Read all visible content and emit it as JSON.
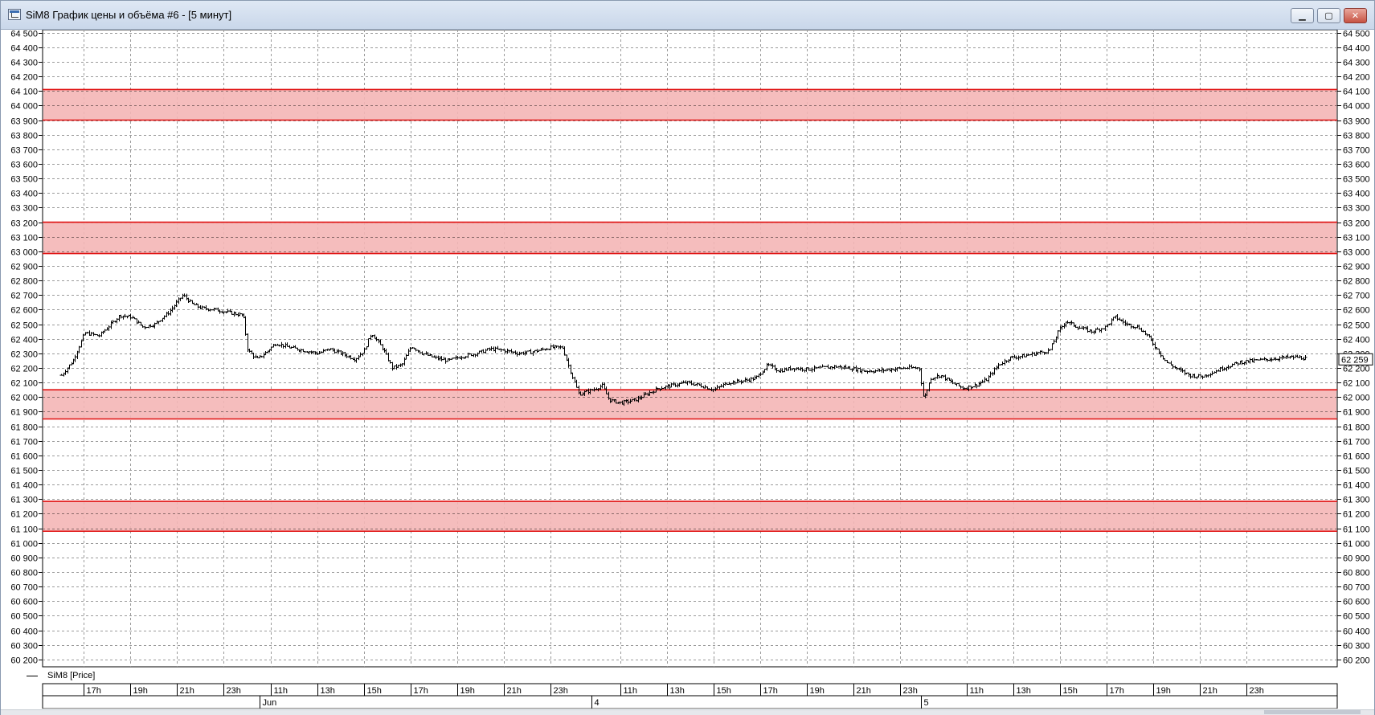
{
  "window": {
    "title": "SiM8 График цены и объёма #6 - [5 минут]",
    "buttons": {
      "minimize": "▁",
      "maximize": "▢",
      "close": "✕"
    },
    "icon": "chart-window-icon"
  },
  "legend": {
    "label": "SiM8 [Price]"
  },
  "colors": {
    "zone_fill": "#f4b6b6",
    "zone_border": "#e01010",
    "bars": "#000000",
    "grid": "#9a9a9a",
    "background": "#ffffff"
  },
  "chart_data": {
    "type": "bar",
    "style": "OHLC bars",
    "interval": "5 минут",
    "ylim": [
      60150,
      64520
    ],
    "y_ticks": [
      64500,
      64400,
      64300,
      64200,
      64100,
      64000,
      63900,
      63800,
      63700,
      63600,
      63500,
      63400,
      63300,
      63200,
      63100,
      63000,
      62900,
      62800,
      62700,
      62600,
      62500,
      62400,
      62300,
      62200,
      62100,
      62000,
      61900,
      61800,
      61700,
      61600,
      61500,
      61400,
      61300,
      61200,
      61100,
      61000,
      60900,
      60800,
      60700,
      60600,
      60500,
      60400,
      60300,
      60200
    ],
    "y_tick_labels": [
      "64 500",
      "64 400",
      "64 300",
      "64 200",
      "64 100",
      "64 000",
      "63 900",
      "63 800",
      "63 700",
      "63 600",
      "63 500",
      "63 400",
      "63 300",
      "63 200",
      "63 100",
      "63 000",
      "62 900",
      "62 800",
      "62 700",
      "62 600",
      "62 500",
      "62 400",
      "62 300",
      "62 200",
      "62 100",
      "62 000",
      "61 900",
      "61 800",
      "61 700",
      "61 600",
      "61 500",
      "61 400",
      "61 300",
      "61 200",
      "61 100",
      "61 000",
      "60 900",
      "60 800",
      "60 700",
      "60 600",
      "60 500",
      "60 400",
      "60 300",
      "60 200"
    ],
    "time_ticks": [
      {
        "label": "17h",
        "t": 0.95
      },
      {
        "label": "19h",
        "t": 2.95
      },
      {
        "label": "21h",
        "t": 4.95
      },
      {
        "label": "23h",
        "t": 6.95
      },
      {
        "label": "11h",
        "t": 9.0
      },
      {
        "label": "13h",
        "t": 11.0
      },
      {
        "label": "15h",
        "t": 13.0
      },
      {
        "label": "17h",
        "t": 15.0
      },
      {
        "label": "19h",
        "t": 17.0
      },
      {
        "label": "21h",
        "t": 19.0
      },
      {
        "label": "23h",
        "t": 21.0
      },
      {
        "label": "11h",
        "t": 24.0
      },
      {
        "label": "13h",
        "t": 26.0
      },
      {
        "label": "15h",
        "t": 28.0
      },
      {
        "label": "17h",
        "t": 30.0
      },
      {
        "label": "19h",
        "t": 32.0
      },
      {
        "label": "21h",
        "t": 34.0
      },
      {
        "label": "23h",
        "t": 36.0
      },
      {
        "label": "11h",
        "t": 38.85
      },
      {
        "label": "13h",
        "t": 40.85
      },
      {
        "label": "15h",
        "t": 42.85
      },
      {
        "label": "17h",
        "t": 44.85
      },
      {
        "label": "19h",
        "t": 46.85
      },
      {
        "label": "21h",
        "t": 48.85
      },
      {
        "label": "23h",
        "t": 50.85
      }
    ],
    "date_ticks": [
      {
        "label": "Jun",
        "t": 8.5
      },
      {
        "label": "4",
        "t": 22.75
      },
      {
        "label": "5",
        "t": 36.9
      }
    ],
    "t_range": [
      -0.8,
      54.75
    ],
    "zones": [
      {
        "low": 63900,
        "high": 64110
      },
      {
        "low": 62985,
        "high": 63200
      },
      {
        "low": 61850,
        "high": 62050
      },
      {
        "low": 61080,
        "high": 61285
      }
    ],
    "price_path": [
      [
        0.0,
        62150
      ],
      [
        0.5,
        62250
      ],
      [
        1.0,
        62440
      ],
      [
        1.6,
        62420
      ],
      [
        2.0,
        62480
      ],
      [
        2.5,
        62560
      ],
      [
        3.0,
        62550
      ],
      [
        3.5,
        62480
      ],
      [
        4.0,
        62500
      ],
      [
        4.6,
        62580
      ],
      [
        5.2,
        62700
      ],
      [
        5.6,
        62640
      ],
      [
        6.0,
        62610
      ],
      [
        6.6,
        62600
      ],
      [
        7.2,
        62580
      ],
      [
        7.8,
        62560
      ],
      [
        8.0,
        62320
      ],
      [
        8.4,
        62260
      ],
      [
        8.8,
        62310
      ],
      [
        9.2,
        62370
      ],
      [
        9.8,
        62340
      ],
      [
        10.4,
        62320
      ],
      [
        11.0,
        62300
      ],
      [
        11.5,
        62330
      ],
      [
        12.0,
        62300
      ],
      [
        12.6,
        62260
      ],
      [
        13.0,
        62320
      ],
      [
        13.3,
        62440
      ],
      [
        13.8,
        62330
      ],
      [
        14.2,
        62200
      ],
      [
        14.6,
        62220
      ],
      [
        15.0,
        62350
      ],
      [
        15.5,
        62300
      ],
      [
        16.0,
        62270
      ],
      [
        16.6,
        62250
      ],
      [
        17.2,
        62280
      ],
      [
        17.8,
        62300
      ],
      [
        18.4,
        62330
      ],
      [
        19.0,
        62320
      ],
      [
        19.6,
        62300
      ],
      [
        20.2,
        62310
      ],
      [
        21.0,
        62340
      ],
      [
        21.5,
        62340
      ],
      [
        21.9,
        62150
      ],
      [
        22.2,
        62020
      ],
      [
        22.8,
        62050
      ],
      [
        23.2,
        62080
      ],
      [
        23.5,
        61980
      ],
      [
        24.0,
        61960
      ],
      [
        24.6,
        61980
      ],
      [
        25.0,
        62010
      ],
      [
        25.6,
        62060
      ],
      [
        26.2,
        62080
      ],
      [
        26.8,
        62100
      ],
      [
        27.4,
        62080
      ],
      [
        28.0,
        62050
      ],
      [
        28.6,
        62100
      ],
      [
        29.2,
        62110
      ],
      [
        29.8,
        62130
      ],
      [
        30.3,
        62220
      ],
      [
        30.8,
        62180
      ],
      [
        31.4,
        62200
      ],
      [
        32.0,
        62190
      ],
      [
        32.6,
        62200
      ],
      [
        33.2,
        62210
      ],
      [
        33.8,
        62200
      ],
      [
        34.4,
        62180
      ],
      [
        35.0,
        62180
      ],
      [
        35.6,
        62190
      ],
      [
        36.2,
        62200
      ],
      [
        36.8,
        62200
      ],
      [
        37.0,
        61980
      ],
      [
        37.3,
        62130
      ],
      [
        37.7,
        62150
      ],
      [
        38.2,
        62100
      ],
      [
        38.7,
        62060
      ],
      [
        39.2,
        62080
      ],
      [
        39.7,
        62120
      ],
      [
        40.2,
        62220
      ],
      [
        40.7,
        62270
      ],
      [
        41.2,
        62280
      ],
      [
        41.8,
        62300
      ],
      [
        42.4,
        62320
      ],
      [
        42.8,
        62460
      ],
      [
        43.1,
        62520
      ],
      [
        43.6,
        62480
      ],
      [
        44.2,
        62450
      ],
      [
        44.8,
        62480
      ],
      [
        45.2,
        62550
      ],
      [
        45.7,
        62500
      ],
      [
        46.2,
        62480
      ],
      [
        46.6,
        62420
      ],
      [
        47.0,
        62330
      ],
      [
        47.4,
        62240
      ],
      [
        47.9,
        62190
      ],
      [
        48.4,
        62150
      ],
      [
        48.9,
        62140
      ],
      [
        49.4,
        62170
      ],
      [
        50.0,
        62210
      ],
      [
        50.6,
        62240
      ],
      [
        51.2,
        62250
      ],
      [
        51.8,
        62260
      ],
      [
        52.4,
        62270
      ],
      [
        53.0,
        62275
      ],
      [
        53.4,
        62265
      ]
    ],
    "last_price": 62259,
    "last_price_label": "62 259"
  }
}
